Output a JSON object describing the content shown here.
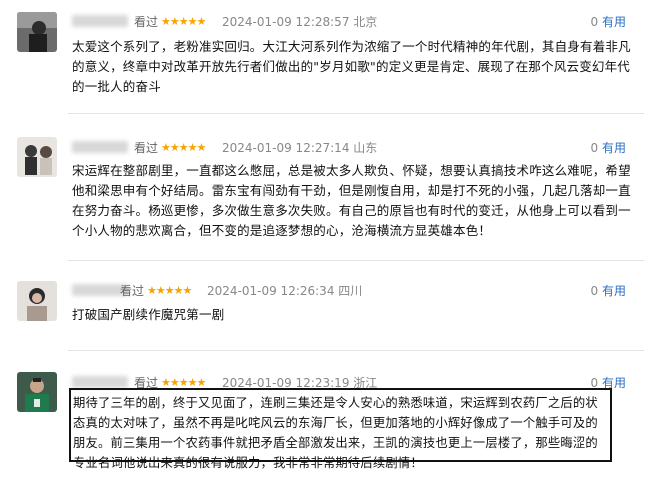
{
  "reviews": [
    {
      "status": "看过",
      "stars": "★★★★★",
      "time": "2024-01-09 12:28:57 北京",
      "useful_count": "0",
      "useful_label": "有用",
      "text": "太爱这个系列了，老粉准实回归。大江大河系列作为浓缩了一个时代精神的年代剧，其自身有着非凡的意义，终章中对改革开放先行者们做出的\"岁月如歌\"的定义更是肯定、展现了在那个风云变幻年代的一批人的奋斗"
    },
    {
      "status": "看过",
      "stars": "★★★★★",
      "time": "2024-01-09 12:27:14 山东",
      "useful_count": "0",
      "useful_label": "有用",
      "text": "宋运辉在整部剧里，一直都这么憋屈，总是被太多人欺负、怀疑，想要认真搞技术咋这么难呢，希望他和梁思申有个好结局。雷东宝有闯劲有干劲，但是刚愎自用，却是打不死的小强，几起几落却一直在努力奋斗。杨巡更惨，多次做生意多次失败。有自己的原旨也有时代的变迁，从他身上可以看到一个小人物的悲欢离合，但不变的是追逐梦想的心，沧海横流方显英雄本色！"
    },
    {
      "status": "看过",
      "stars": "★★★★★",
      "time": "2024-01-09 12:26:34 四川",
      "useful_count": "0",
      "useful_label": "有用",
      "text": "打破国产剧续作魔咒第一剧"
    },
    {
      "status": "看过",
      "stars": "★★★★★",
      "time": "2024-01-09 12:23:19 浙江",
      "useful_count": "0",
      "useful_label": "有用",
      "text": "期待了三年的剧，终于又见面了，连刷三集还是令人安心的熟悉味道，宋运辉到农药厂之后的状态真的太对味了，虽然不再是叱咤风云的东海厂长，但更加落地的小辉好像成了一个触手可及的朋友。前三集用一个农药事件就把矛盾全部激发出来，王凯的演技也更上一层楼了，那些晦涩的专业名词他说出来真的很有说服力，我非常非常期待后续剧情！"
    }
  ],
  "colors": {
    "star": "#f5a400",
    "link": "#2a6fc1",
    "meta": "#888888"
  }
}
